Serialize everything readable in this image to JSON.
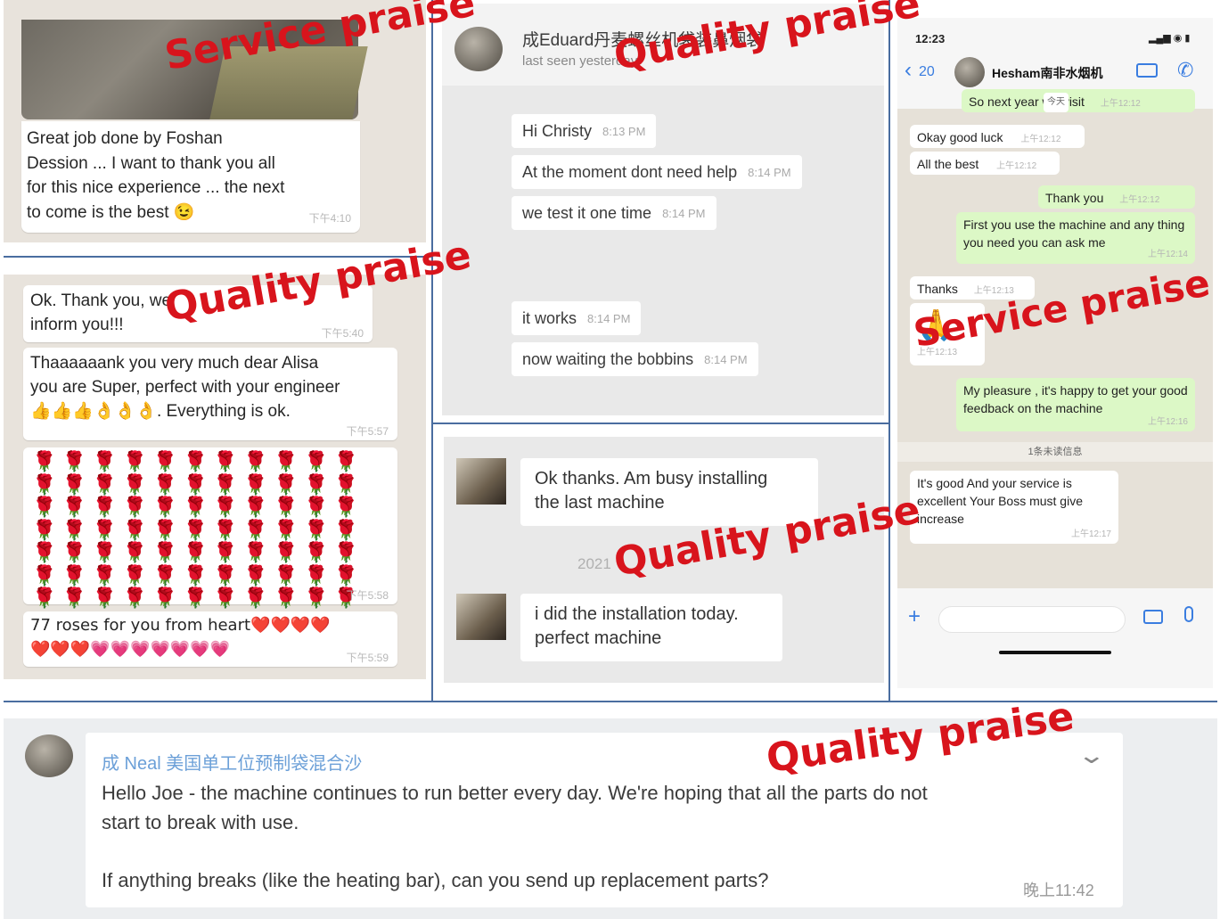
{
  "watermarks": {
    "service_praise": "Service praise",
    "quality_praise": "Quality praise"
  },
  "panel_foshan": {
    "message": [
      "Great job done by Foshan",
      "Dession ... I want to thank you all",
      "for this nice experience ... the next",
      "to come is the best 😉"
    ],
    "time": "下午4:10"
  },
  "panel_alisa": {
    "messages": [
      {
        "lines": [
          "Ok. Thank you, we",
          "inform you!!!"
        ],
        "time": "下午5:40"
      },
      {
        "lines": [
          "Thaaaaaank you very much dear Alisa",
          "you are Super, perfect with your engineer",
          "👍👍👍👌👌👌. Everything is ok."
        ],
        "time": "下午5:57"
      },
      {
        "roses": "🌹🌹🌹🌹🌹🌹🌹🌹🌹🌹🌹🌹🌹🌹🌹🌹🌹🌹🌹🌹🌹🌹🌹🌹🌹🌹🌹🌹🌹🌹🌹🌹🌹🌹🌹🌹🌹🌹🌹🌹🌹🌹🌹🌹🌹🌹🌹🌹🌹🌹🌹🌹🌹🌹🌹🌹🌹🌹🌹🌹🌹🌹🌹🌹🌹🌹🌹🌹🌹🌹🌹🌹🌹🌹🌹🌹🌹",
        "time": "下午5:58"
      },
      {
        "lines": [
          "77 roses for you from heart❤️❤️❤️❤️",
          "❤️❤️❤️💗💗💗💗💗💗💗"
        ],
        "time": "下午5:59"
      }
    ]
  },
  "panel_eduard": {
    "contact_name": "成Eduard丹麦螺丝机袋装鼻烟袋",
    "last_seen": "last seen yesterday",
    "messages": [
      {
        "text": "Hi Christy",
        "time": "8:13 PM"
      },
      {
        "text": "At the moment dont need help",
        "time": "8:14 PM"
      },
      {
        "text": "we test it one time",
        "time": "8:14 PM"
      },
      {
        "text": "it works",
        "time": "8:14 PM"
      },
      {
        "text": "now waiting the bobbins",
        "time": "8:14 PM"
      }
    ]
  },
  "panel_install": {
    "messages": [
      {
        "lines": [
          "Ok thanks.  Am busy installing",
          "the last machine"
        ]
      },
      {
        "lines": [
          "i did the installation today.",
          "perfect machine"
        ]
      }
    ],
    "date_sep": "2021"
  },
  "panel_phone": {
    "status_time": "12:23",
    "back_count": "20",
    "contact": "Hesham南非水烟机",
    "today": "今天",
    "unread": "1条未读信息",
    "messages": [
      {
        "text": "So next year will visit",
        "time": "上午12:12",
        "side": "out"
      },
      {
        "text": "Okay good luck",
        "time": "上午12:12",
        "side": "in"
      },
      {
        "text": "All the best",
        "time": "上午12:12",
        "side": "in"
      },
      {
        "text": "Thank you",
        "time": "上午12:12",
        "side": "out"
      },
      {
        "text": "First you use the machine and any thing you need you can ask me",
        "time": "上午12:14",
        "side": "out"
      },
      {
        "text": "Thanks",
        "time": "上午12:13",
        "side": "in"
      },
      {
        "text": "🙏",
        "time": "上午12:13",
        "side": "in"
      },
      {
        "text": "My pleasure , it's happy to get your good feedback on the machine",
        "time": "上午12:16",
        "side": "out"
      },
      {
        "text": "It's good And your service is excellent Your Boss must give increase",
        "time": "上午12:17",
        "side": "in"
      }
    ]
  },
  "panel_neal": {
    "sender": "成 Neal 美国单工位预制袋混合沙",
    "paragraph1": [
      "Hello Joe - the machine continues to run better every day.  We're hoping that all the parts do not",
      "start to break with use."
    ],
    "paragraph2": "If anything breaks (like the heating bar), can you send up replacement parts?",
    "time": "晚上11:42"
  },
  "colors": {
    "watermark": "#d8141c",
    "chat_bg": "#e8e3dc",
    "outgoing_bubble": "#dcf8c6",
    "divider": "#4a6da0",
    "link_blue": "#6ca0d8"
  }
}
